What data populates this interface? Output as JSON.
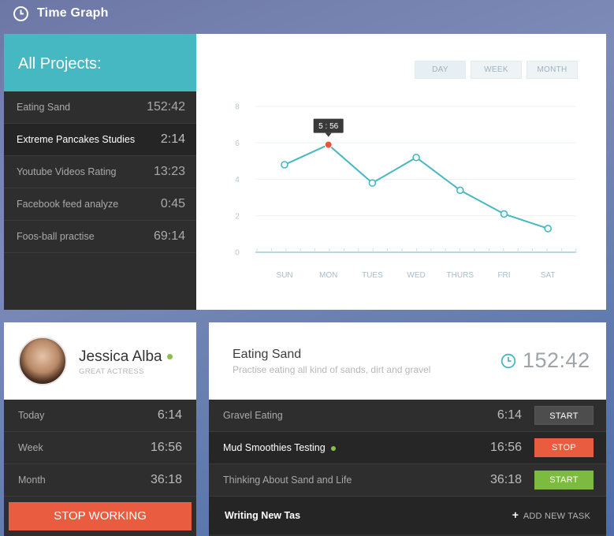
{
  "app": {
    "title": "Time Graph"
  },
  "projects": {
    "heading": "All Projects:",
    "items": [
      {
        "name": "Eating Sand",
        "time": "152:42"
      },
      {
        "name": "Extreme Pancakes Studies",
        "time": "2:14"
      },
      {
        "name": "Youtube Videos Rating",
        "time": "13:23"
      },
      {
        "name": "Facebook feed analyze",
        "time": "0:45"
      },
      {
        "name": "Foos-ball practise",
        "time": "69:14"
      }
    ]
  },
  "chart": {
    "buttons": [
      "DAY",
      "WEEK",
      "MONTH"
    ],
    "tooltip": "5 : 56"
  },
  "chart_data": {
    "type": "line",
    "categories": [
      "SUN",
      "MON",
      "TUES",
      "WED",
      "THURS",
      "FRI",
      "SAT"
    ],
    "values": [
      4.8,
      5.9,
      3.8,
      5.2,
      3.4,
      2.1,
      1.3
    ],
    "ylim": [
      0,
      8
    ],
    "yticks": [
      0,
      2,
      4,
      6,
      8
    ],
    "highlight_index": 1,
    "grid": true,
    "colors": {
      "line": "#46b8c2",
      "highlight": "#e8553d"
    }
  },
  "profile": {
    "name": "Jessica Alba",
    "role": "GREAT ACTRESS",
    "stats": [
      {
        "label": "Today",
        "value": "6:14"
      },
      {
        "label": "Week",
        "value": "16:56"
      },
      {
        "label": "Month",
        "value": "36:18"
      }
    ],
    "stop_label": "STOP WORKING"
  },
  "task": {
    "name": "Eating Sand",
    "description": "Practise eating all kind of sands, dirt and gravel",
    "total": "152:42",
    "items": [
      {
        "name": "Gravel Eating",
        "time": "6:14",
        "action": "START"
      },
      {
        "name": "Mud Smoothies Testing",
        "time": "16:56",
        "action": "STOP"
      },
      {
        "name": "Thinking About Sand and Life",
        "time": "36:18",
        "action": "START"
      }
    ],
    "new_task_value": "Writing New Tas",
    "add_label": "ADD NEW TASK"
  }
}
